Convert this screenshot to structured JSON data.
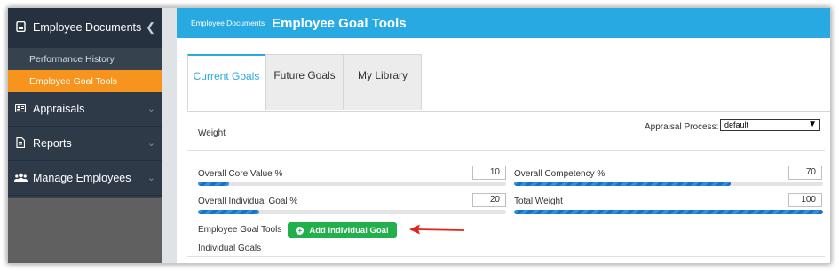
{
  "sidebar": {
    "sections": {
      "employee_documents": {
        "label": "Employee Documents",
        "icon": "document-icon"
      },
      "appraisals": {
        "label": "Appraisals",
        "icon": "id-card-icon"
      },
      "reports": {
        "label": "Reports",
        "icon": "report-icon"
      },
      "manage_employees": {
        "label": "Manage Employees",
        "icon": "users-icon"
      }
    },
    "sub_items": [
      "Performance History",
      "Employee Goal Tools"
    ],
    "current_sub_item": "Employee Goal Tools",
    "accent_color": "#f7941d"
  },
  "header": {
    "breadcrumb": "Employee Documents",
    "title": "Employee Goal Tools",
    "color": "#29a9e1"
  },
  "tabs": [
    "Current Goals",
    "Future Goals",
    "My Library"
  ],
  "active_tab": "Current Goals",
  "weight": {
    "heading": "Weight",
    "appraisal_process_label": "Appraisal Process:",
    "appraisal_process_value": "default"
  },
  "fields": {
    "overall_core_value": {
      "label": "Overall Core Value %",
      "value": "10",
      "fraction": 0.1
    },
    "overall_competency": {
      "label": "Overall Competency %",
      "value": "70",
      "fraction": 0.7
    },
    "overall_individual_goal": {
      "label": "Overall Individual Goal %",
      "value": "20",
      "fraction": 0.2
    },
    "total_weight": {
      "label": "Total Weight",
      "value": "100",
      "fraction": 1.0
    }
  },
  "goal_tools": {
    "label": "Employee Goal Tools",
    "add_button_label": "Add Individual Goal",
    "individual_goals_heading": "Individual Goals",
    "button_color": "#21b04b",
    "annotation_arrow_color": "#e2231a"
  }
}
